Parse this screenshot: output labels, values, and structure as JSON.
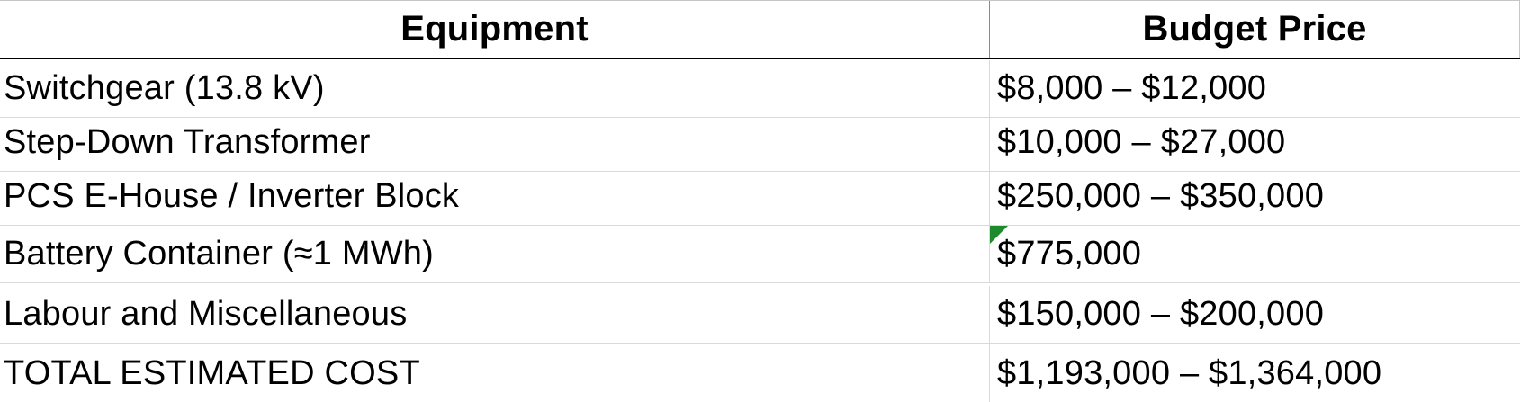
{
  "table": {
    "headers": {
      "equipment": "Equipment",
      "budget_price": "Budget Price"
    },
    "rows": [
      {
        "equipment": "Switchgear (13.8 kV)",
        "budget_price": "$8,000 – $12,000"
      },
      {
        "equipment": "Step-Down Transformer",
        "budget_price": "$10,000 – $27,000"
      },
      {
        "equipment": "PCS E-House / Inverter Block",
        "budget_price": "$250,000 – $350,000"
      },
      {
        "equipment": "Battery Container (≈1 MWh)",
        "budget_price": "$775,000"
      },
      {
        "equipment": "Labour and Miscellaneous",
        "budget_price": "$150,000 – $200,000"
      },
      {
        "equipment": "TOTAL ESTIMATED COST",
        "budget_price": "$1,193,000 – $1,364,000"
      }
    ]
  },
  "colors": {
    "header_border": "#000000",
    "grid_line": "#d9d9d9",
    "comment_marker": "#1e8a2e"
  }
}
